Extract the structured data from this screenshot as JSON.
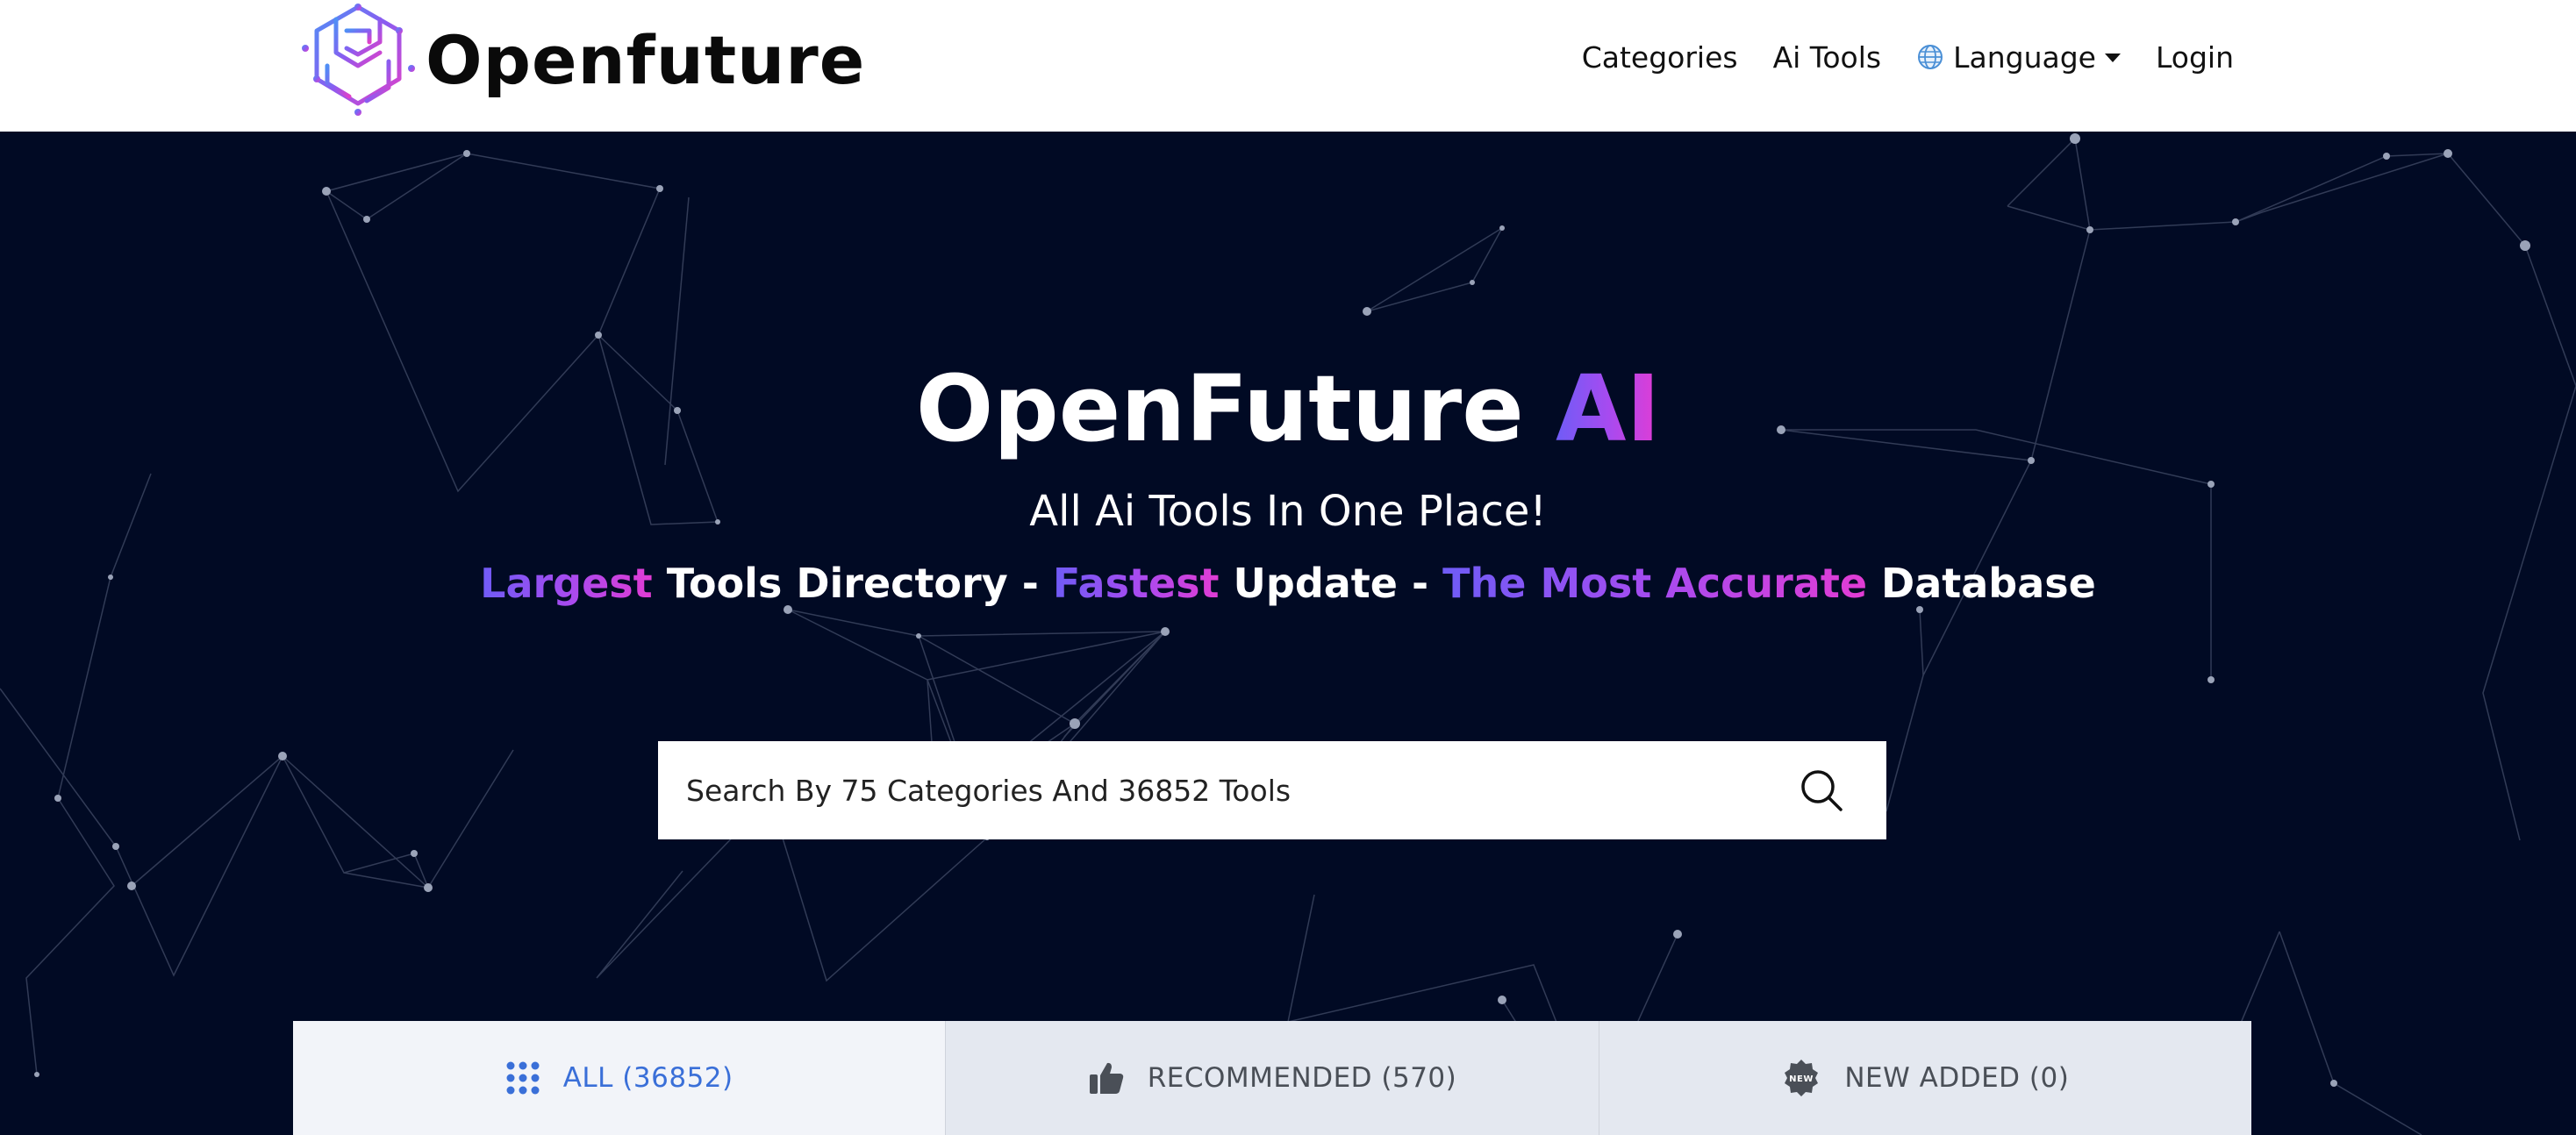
{
  "header": {
    "logo_text": "Openfuture",
    "nav": {
      "categories": "Categories",
      "ai_tools": "Ai Tools",
      "language": "Language",
      "login": "Login"
    }
  },
  "hero": {
    "title_main": "OpenFuture ",
    "title_accent": "AI",
    "subtitle": "All Ai Tools In One Place!",
    "tagline": {
      "part1_accent": "Largest",
      "part1": " Tools Directory - ",
      "part2_accent": "Fastest",
      "part2": " Update - ",
      "part3_accent": "The Most Accurate",
      "part3": " Database"
    },
    "search": {
      "placeholder": "Search By 75 Categories And 36852 Tools",
      "value": ""
    }
  },
  "tabs": [
    {
      "label": "ALL (36852)",
      "icon": "grid-icon",
      "active": true
    },
    {
      "label": "RECOMMENDED (570)",
      "icon": "thumbs-up-icon",
      "active": false
    },
    {
      "label": "NEW ADDED (0)",
      "icon": "new-badge-icon",
      "active": false
    }
  ],
  "colors": {
    "hero_bg": "#010a24",
    "gradient_start": "#6f5cf6",
    "gradient_end": "#e23cd4",
    "active_tab_text": "#3a6fd8",
    "active_tab_bg": "#f2f4f9",
    "inactive_tab_bg": "#e4e8f0"
  }
}
